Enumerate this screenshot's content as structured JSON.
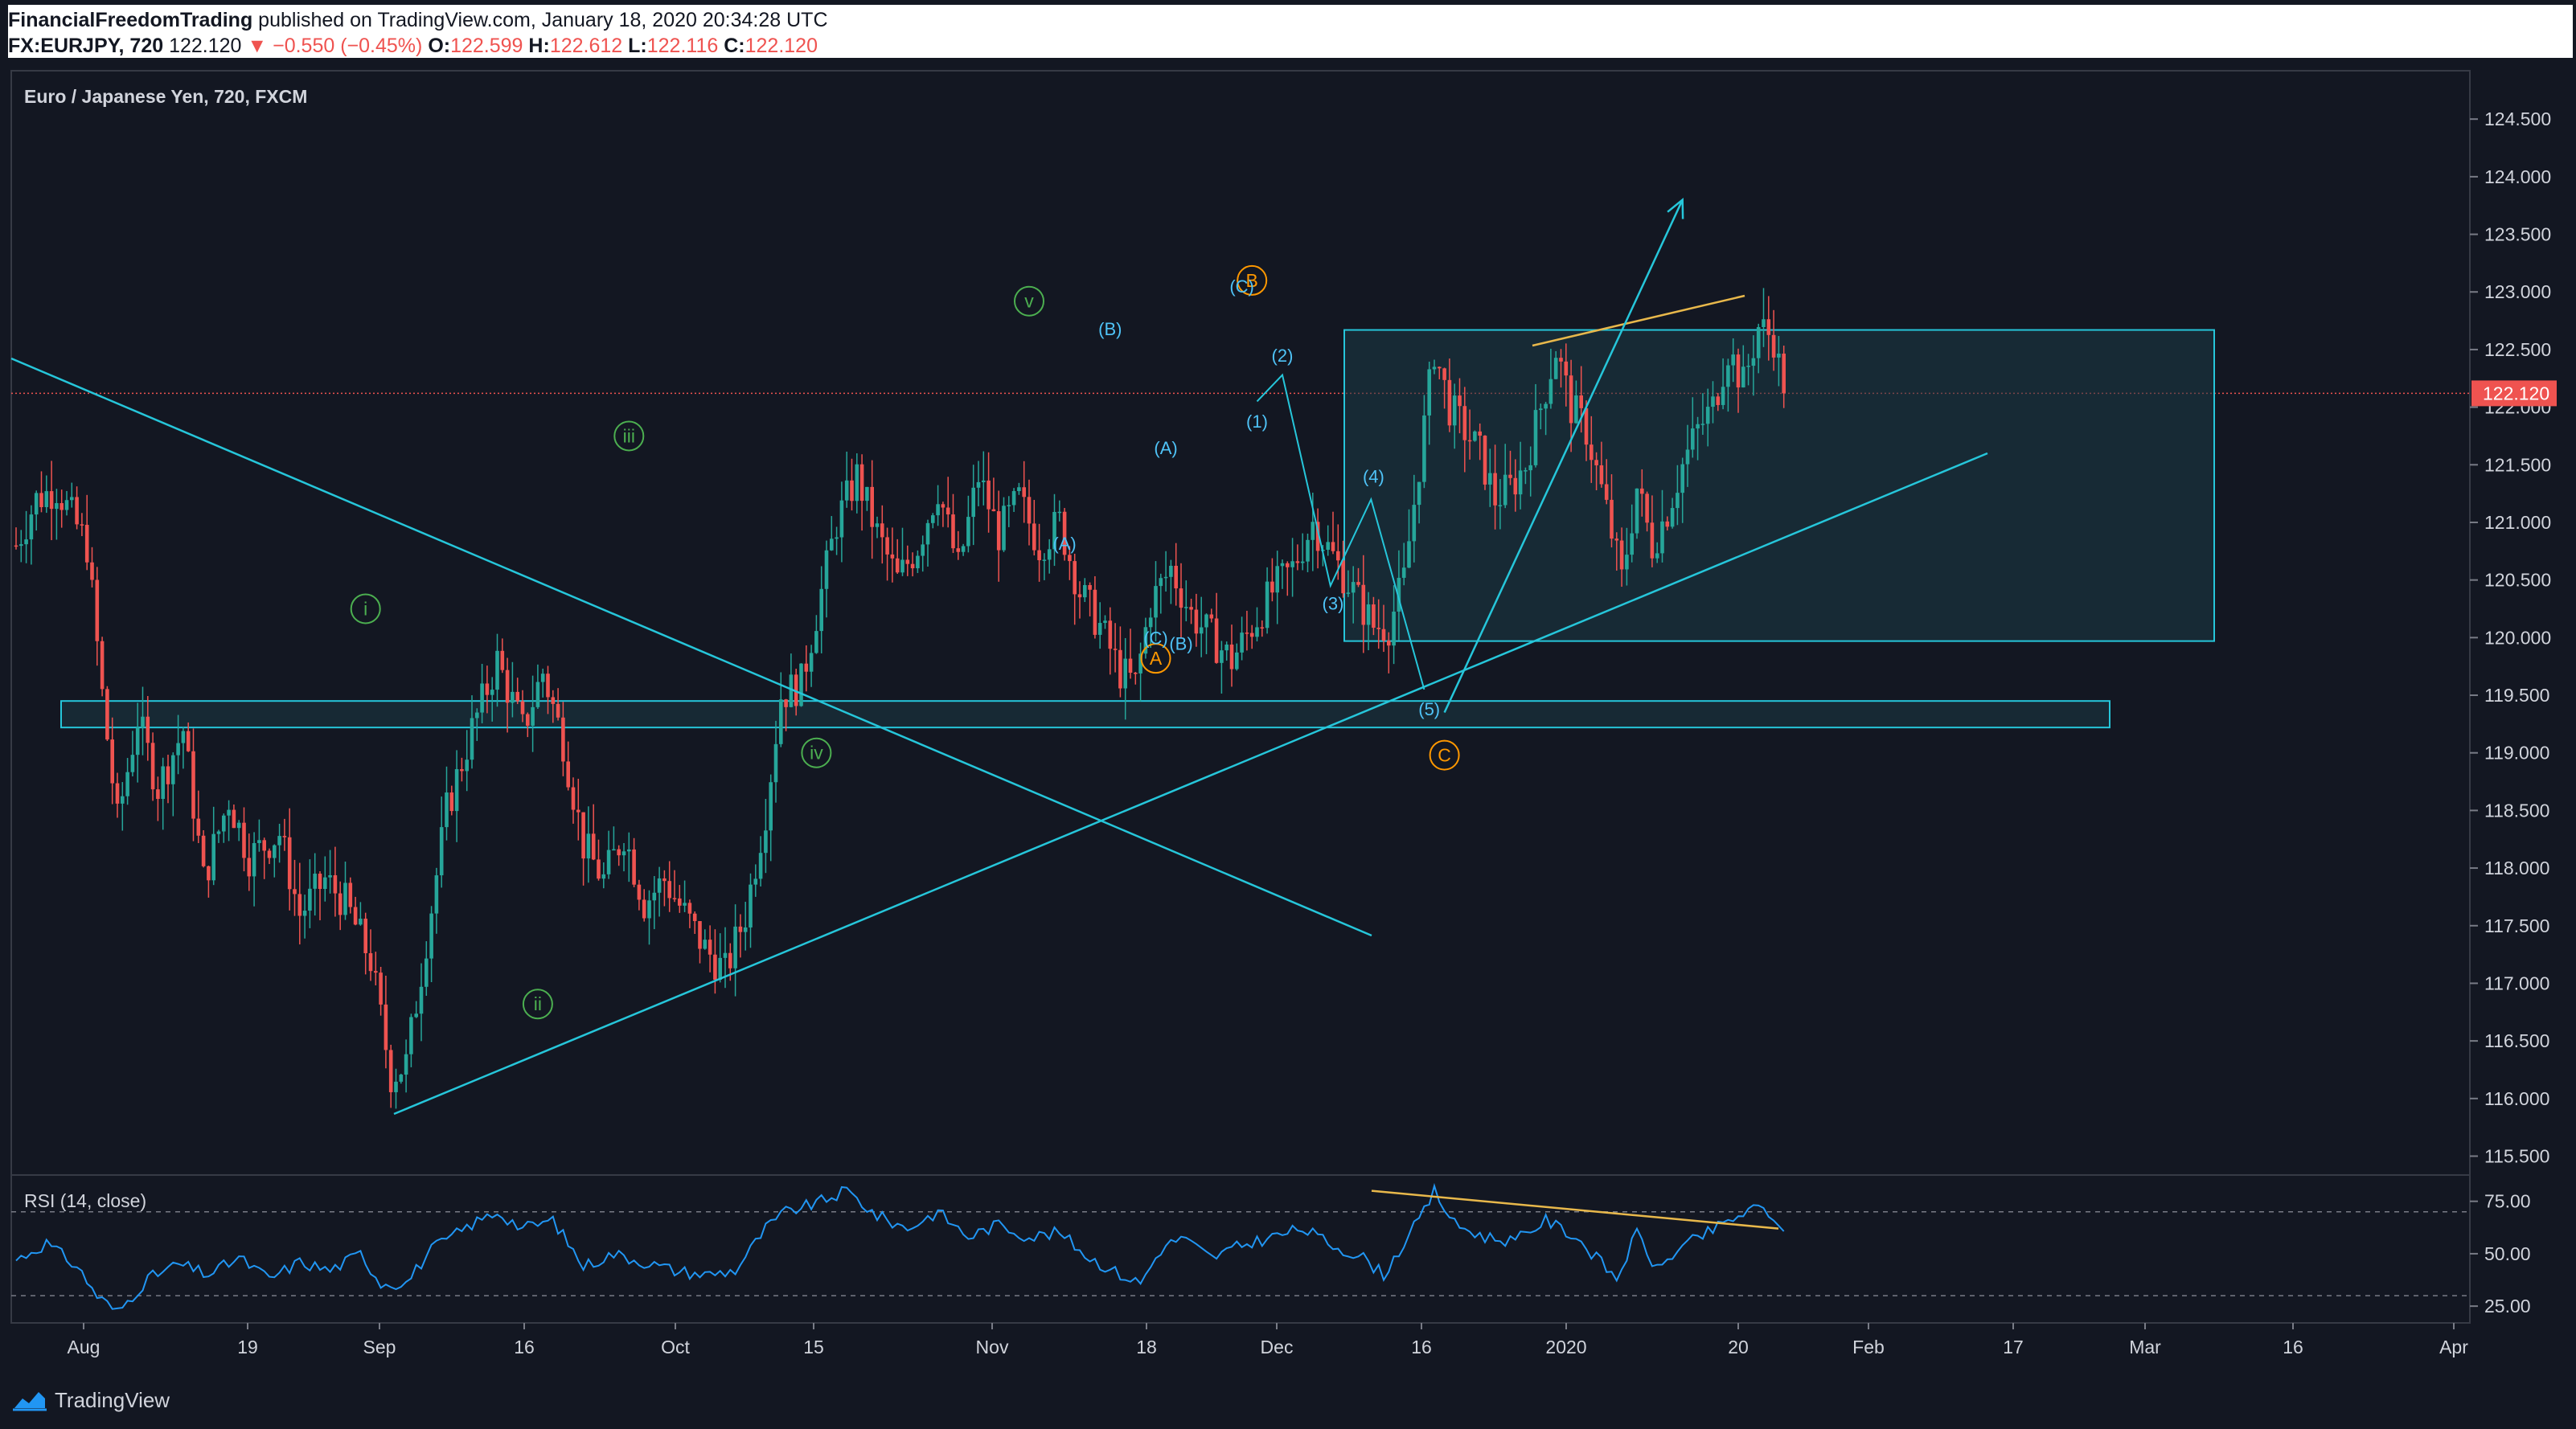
{
  "header": {
    "publisher": "FinancialFreedomTrading",
    "published_text": " published on TradingView.com, January 18, 2020 20:34:28 UTC",
    "symbol": "FX:EURJPY, 720",
    "last": "122.120",
    "change": "▼ −0.550 (−0.45%)",
    "o_label": "O:",
    "o_value": "122.599",
    "h_label": "H:",
    "h_value": "122.612",
    "l_label": "L:",
    "l_value": "122.116",
    "c_label": "C:",
    "c_value": "122.120"
  },
  "footer": {
    "brand": "TradingView"
  },
  "colors": {
    "background": "#131722",
    "grid": "#2a2e39",
    "axis_text": "#d1d4dc",
    "up": "#26a69a",
    "down": "#ef5350",
    "trendline": "#26c6da",
    "zone_fill": "#1b3b45",
    "zone_stroke": "#26c6da",
    "wave_green": "#4caf50",
    "wave_orange": "#ff9800",
    "rsi_line": "#2196f3",
    "divergence": "#e8b84b"
  },
  "chart_data": {
    "type": "candlestick",
    "title": "Euro / Japanese Yen, 720, FXCM",
    "x_ticks": [
      "Aug",
      "19",
      "Sep",
      "16",
      "Oct",
      "15",
      "Nov",
      "18",
      "Dec",
      "16",
      "2020",
      "20",
      "Feb",
      "17",
      "Mar",
      "16",
      "Apr"
    ],
    "y_ticks": [
      "124.500",
      "124.000",
      "123.500",
      "123.000",
      "122.500",
      "122.000",
      "121.500",
      "121.000",
      "120.500",
      "120.000",
      "119.500",
      "119.000",
      "118.500",
      "118.000",
      "117.500",
      "117.000",
      "116.500",
      "116.000",
      "115.500"
    ],
    "ylim": [
      115.35,
      124.85
    ],
    "last_price_label": "122.120",
    "last_price": 122.12,
    "anchors": [
      [
        0,
        120.8
      ],
      [
        4,
        121.2
      ],
      [
        8,
        121.3
      ],
      [
        14,
        120.8
      ],
      [
        17,
        119.5
      ],
      [
        20,
        118.4
      ],
      [
        24,
        119.3
      ],
      [
        28,
        118.7
      ],
      [
        33,
        119.2
      ],
      [
        37,
        117.9
      ],
      [
        42,
        118.6
      ],
      [
        46,
        118.1
      ],
      [
        52,
        118.3
      ],
      [
        56,
        117.6
      ],
      [
        61,
        117.9
      ],
      [
        65,
        117.7
      ],
      [
        70,
        117.2
      ],
      [
        74,
        116.2
      ],
      [
        77,
        116.3
      ],
      [
        80,
        117.1
      ],
      [
        85,
        118.5
      ],
      [
        90,
        119.2
      ],
      [
        95,
        119.8
      ],
      [
        100,
        119.2
      ],
      [
        104,
        119.7
      ],
      [
        108,
        119.1
      ],
      [
        112,
        118.2
      ],
      [
        116,
        117.9
      ],
      [
        120,
        118.3
      ],
      [
        124,
        117.7
      ],
      [
        128,
        117.9
      ],
      [
        132,
        117.6
      ],
      [
        136,
        117.3
      ],
      [
        140,
        117.1
      ],
      [
        144,
        117.6
      ],
      [
        148,
        118.5
      ],
      [
        151,
        119.5
      ],
      [
        155,
        119.6
      ],
      [
        158,
        120.2
      ],
      [
        162,
        121.0
      ],
      [
        166,
        121.4
      ],
      [
        170,
        120.9
      ],
      [
        174,
        120.5
      ],
      [
        178,
        120.8
      ],
      [
        182,
        121.3
      ],
      [
        186,
        120.6
      ],
      [
        190,
        121.4
      ],
      [
        194,
        120.9
      ],
      [
        198,
        121.2
      ],
      [
        202,
        120.8
      ],
      [
        206,
        121.0
      ],
      [
        210,
        120.4
      ],
      [
        214,
        120.1
      ],
      [
        218,
        119.7
      ],
      [
        221,
        119.6
      ],
      [
        224,
        120.3
      ],
      [
        228,
        120.6
      ],
      [
        232,
        120.2
      ],
      [
        236,
        120.0
      ],
      [
        240,
        119.8
      ],
      [
        244,
        120.1
      ],
      [
        248,
        120.4
      ],
      [
        252,
        120.6
      ],
      [
        256,
        121.0
      ],
      [
        260,
        120.7
      ],
      [
        264,
        120.4
      ],
      [
        268,
        120.1
      ],
      [
        271,
        120.1
      ],
      [
        274,
        120.5
      ],
      [
        277,
        121.5
      ],
      [
        280,
        122.5
      ],
      [
        283,
        122.0
      ],
      [
        286,
        121.8
      ],
      [
        289,
        121.6
      ],
      [
        292,
        121.2
      ],
      [
        295,
        121.3
      ],
      [
        298,
        121.5
      ],
      [
        301,
        122.0
      ],
      [
        304,
        122.5
      ],
      [
        307,
        122.0
      ],
      [
        310,
        121.8
      ],
      [
        314,
        121.1
      ],
      [
        317,
        120.5
      ],
      [
        320,
        121.3
      ],
      [
        323,
        120.8
      ],
      [
        326,
        121.1
      ],
      [
        329,
        121.5
      ],
      [
        332,
        121.8
      ],
      [
        335,
        122.0
      ],
      [
        338,
        122.5
      ],
      [
        341,
        122.2
      ],
      [
        344,
        122.7
      ],
      [
        347,
        122.6
      ],
      [
        349,
        122.12
      ]
    ],
    "rsi": {
      "label": "RSI (14, close)",
      "y_ticks": [
        "75.00",
        "50.00",
        "25.00"
      ],
      "ylim": [
        17,
        86
      ],
      "levels": [
        70,
        30
      ],
      "anchors": [
        [
          0,
          47
        ],
        [
          6,
          55
        ],
        [
          12,
          44
        ],
        [
          16,
          30
        ],
        [
          20,
          22
        ],
        [
          26,
          38
        ],
        [
          32,
          45
        ],
        [
          38,
          40
        ],
        [
          44,
          48
        ],
        [
          50,
          38
        ],
        [
          56,
          46
        ],
        [
          62,
          42
        ],
        [
          68,
          50
        ],
        [
          72,
          36
        ],
        [
          77,
          36
        ],
        [
          82,
          52
        ],
        [
          90,
          64
        ],
        [
          95,
          70
        ],
        [
          100,
          62
        ],
        [
          106,
          66
        ],
        [
          112,
          44
        ],
        [
          118,
          50
        ],
        [
          124,
          46
        ],
        [
          130,
          42
        ],
        [
          136,
          40
        ],
        [
          142,
          42
        ],
        [
          148,
          62
        ],
        [
          152,
          70
        ],
        [
          158,
          74
        ],
        [
          164,
          80
        ],
        [
          170,
          68
        ],
        [
          176,
          62
        ],
        [
          182,
          70
        ],
        [
          188,
          58
        ],
        [
          194,
          64
        ],
        [
          200,
          58
        ],
        [
          206,
          60
        ],
        [
          212,
          48
        ],
        [
          218,
          40
        ],
        [
          222,
          36
        ],
        [
          226,
          52
        ],
        [
          230,
          58
        ],
        [
          236,
          48
        ],
        [
          242,
          54
        ],
        [
          248,
          58
        ],
        [
          254,
          62
        ],
        [
          260,
          54
        ],
        [
          266,
          48
        ],
        [
          270,
          40
        ],
        [
          274,
          55
        ],
        [
          278,
          70
        ],
        [
          280,
          80
        ],
        [
          284,
          64
        ],
        [
          290,
          58
        ],
        [
          296,
          56
        ],
        [
          302,
          66
        ],
        [
          308,
          58
        ],
        [
          312,
          48
        ],
        [
          316,
          38
        ],
        [
          320,
          60
        ],
        [
          324,
          42
        ],
        [
          328,
          52
        ],
        [
          334,
          60
        ],
        [
          340,
          68
        ],
        [
          344,
          72
        ],
        [
          347,
          68
        ],
        [
          349,
          58
        ]
      ]
    }
  },
  "annotations": {
    "waves": [
      {
        "text": "i",
        "x": 69,
        "price": 120.25,
        "style": "green"
      },
      {
        "text": "ii",
        "x": 103,
        "price": 116.82,
        "style": "green"
      },
      {
        "text": "iii",
        "x": 121,
        "price": 121.75,
        "style": "green"
      },
      {
        "text": "iv",
        "x": 158,
        "price": 119.0,
        "style": "green"
      },
      {
        "text": "v",
        "x": 200,
        "price": 122.92,
        "style": "green"
      },
      {
        "text": "A",
        "x": 225,
        "price": 119.82,
        "style": "orange"
      },
      {
        "text": "B",
        "x": 244,
        "price": 123.1,
        "style": "orange"
      },
      {
        "text": "C",
        "x": 282,
        "price": 118.98,
        "style": "orange"
      },
      {
        "text": "(A)",
        "x": 207,
        "price": 120.82,
        "style": "cyan"
      },
      {
        "text": "(B)",
        "x": 216,
        "price": 122.68,
        "style": "cyan"
      },
      {
        "text": "(C)",
        "x": 225,
        "price": 120.0,
        "style": "cyan"
      },
      {
        "text": "(A)",
        "x": 227,
        "price": 121.65,
        "style": "cyan"
      },
      {
        "text": "(B)",
        "x": 230,
        "price": 119.95,
        "style": "cyan"
      },
      {
        "text": "(C)",
        "x": 242,
        "price": 123.05,
        "style": "cyan"
      },
      {
        "text": "(1)",
        "x": 245,
        "price": 121.88,
        "style": "cyan"
      },
      {
        "text": "(2)",
        "x": 250,
        "price": 122.45,
        "style": "cyan"
      },
      {
        "text": "(3)",
        "x": 260,
        "price": 120.3,
        "style": "cyan"
      },
      {
        "text": "(4)",
        "x": 268,
        "price": 121.4,
        "style": "cyan"
      },
      {
        "text": "(5)",
        "x": 279,
        "price": 119.38,
        "style": "cyan"
      }
    ],
    "projection": [
      [
        245,
        122.05
      ],
      [
        250,
        122.28
      ],
      [
        259.5,
        120.45
      ],
      [
        267.5,
        121.2
      ],
      [
        278,
        119.55
      ]
    ],
    "arrow": [
      [
        282,
        119.35
      ],
      [
        329,
        123.8
      ]
    ]
  }
}
